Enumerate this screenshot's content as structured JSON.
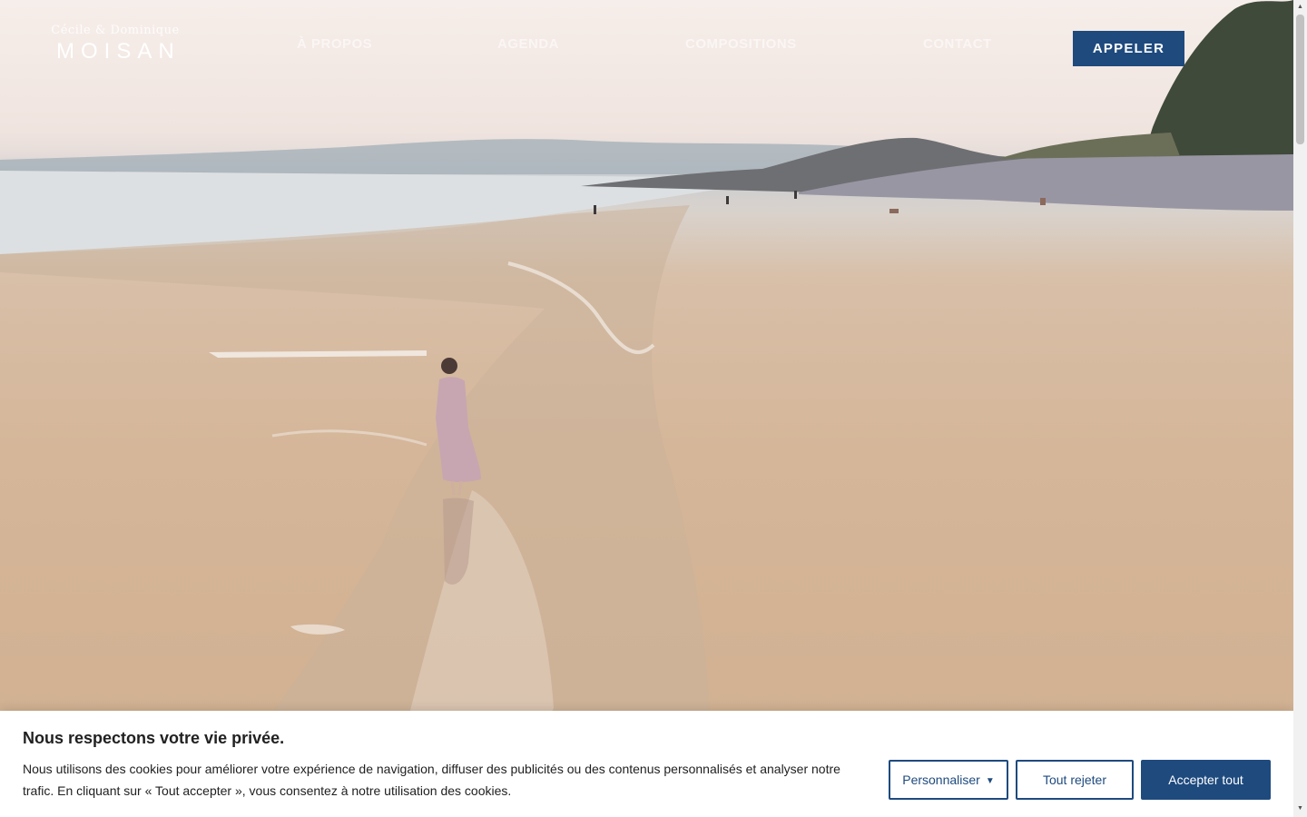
{
  "logo": {
    "subtitle": "Cécile & Dominique",
    "name": "MOISAN"
  },
  "nav": [
    {
      "label": "À PROPOS"
    },
    {
      "label": "AGENDA"
    },
    {
      "label": "COMPOSITIONS"
    },
    {
      "label": "CONTACT"
    }
  ],
  "call_button": {
    "label": "APPELER"
  },
  "cookie_banner": {
    "title": "Nous respectons votre vie privée.",
    "text": "Nous utilisons des cookies pour améliorer votre expérience de navigation, diffuser des publicités ou des contenus personnalisés et analyser notre trafic. En cliquant sur « Tout accepter », vous consentez à notre utilisation des cookies.",
    "customize_label": "Personnaliser",
    "reject_label": "Tout rejeter",
    "accept_label": "Accepter tout"
  },
  "colors": {
    "brand": "#1e4a7e",
    "banner_bg": "#ffffff",
    "text": "#212121"
  },
  "icons": {
    "dropdown": "caret-down-icon",
    "scroll_up": "scroll-up-arrow-icon",
    "scroll_down": "scroll-down-arrow-icon"
  }
}
